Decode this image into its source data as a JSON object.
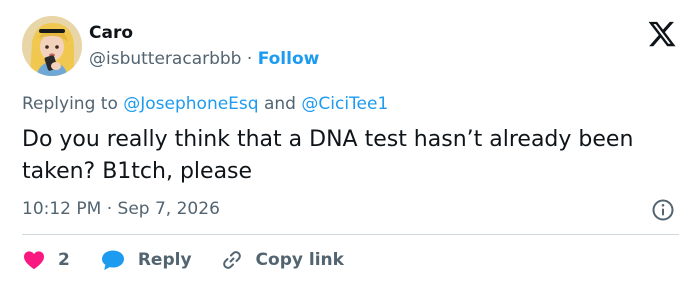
{
  "author": {
    "name": "Caro",
    "handle": "@isbutteracarbbb",
    "separator": "·",
    "follow_label": "Follow"
  },
  "reply_context": {
    "prefix": "Replying to",
    "mention_1": "@JosephoneEsq",
    "conjunction": "and",
    "mention_2": "@CiciTee1"
  },
  "tweet": {
    "text": "Do you really think that a DNA test hasn’t already been taken? B1tch, please",
    "time": "10:12 PM",
    "separator": "·",
    "date": "Sep 7, 2026"
  },
  "actions": {
    "like_count": "2",
    "reply_label": "Reply",
    "copy_link_label": "Copy link"
  },
  "icons": {
    "logo": "x-logo-icon",
    "info": "info-icon",
    "like": "heart-icon",
    "reply": "speech-bubble-icon",
    "copy": "link-icon"
  },
  "colors": {
    "text": "#0f1419",
    "secondary": "#536471",
    "accent": "#1d9bf0",
    "like": "#f91880",
    "divider": "#cfd9de"
  }
}
